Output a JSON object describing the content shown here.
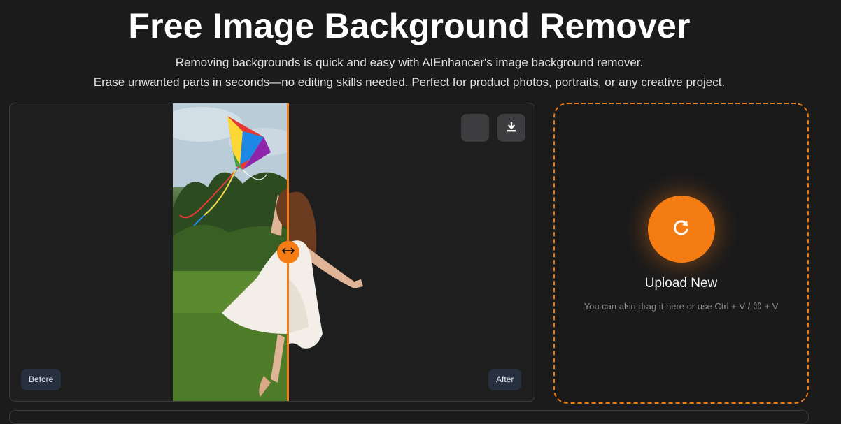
{
  "header": {
    "title": "Free Image Background Remover",
    "subtitle_line1": "Removing backgrounds is quick and easy with AIEnhancer's image background remover.",
    "subtitle_line2": "Erase unwanted parts in seconds—no editing skills needed. Perfect for product photos, portraits, or any creative project."
  },
  "compare": {
    "before_label": "Before",
    "after_label": "After",
    "slider_position": 0.53,
    "image_subject": "girl-flying-rainbow-kite",
    "icons": [
      "background-color-icon",
      "download-icon",
      "split-arrows-icon"
    ]
  },
  "upload": {
    "title": "Upload New",
    "hint": "You can also drag it here or use Ctrl + V / ⌘ + V",
    "icon": "refresh-icon"
  },
  "colors": {
    "accent": "#f57c12",
    "background": "#1b1b1c",
    "panel_border": "#3a3a3c",
    "tag_background": "#26303f"
  }
}
